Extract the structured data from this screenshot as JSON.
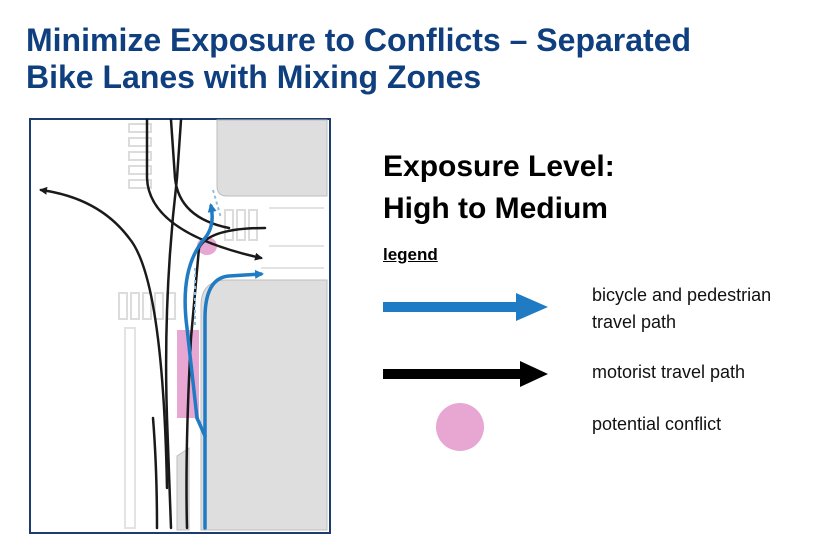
{
  "title": {
    "line1": "Minimize Exposure to Conflicts – Separated",
    "line2": "Bike Lanes with Mixing Zones"
  },
  "exposure": {
    "line1": "Exposure Level:",
    "line2": "High to Medium"
  },
  "legend": {
    "title": "legend",
    "items": [
      {
        "line1": "bicycle and pedestrian",
        "line2": "travel path",
        "symbol": "arrow",
        "color": "#1f7bc4"
      },
      {
        "line1": "motorist travel path",
        "symbol": "arrow",
        "color": "#000000"
      },
      {
        "line1": "potential conflict",
        "symbol": "circle",
        "color": "#e8a6d2"
      }
    ]
  },
  "colors": {
    "title": "#0f3f7e",
    "bike_path": "#1f7bc4",
    "motorist_path": "#1a1a1a",
    "conflict": "#e8a6d2",
    "block": "#dedede"
  }
}
